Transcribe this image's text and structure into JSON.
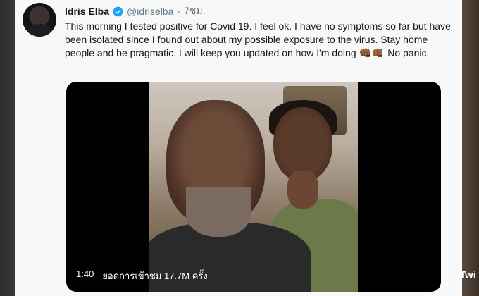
{
  "tweet": {
    "display_name": "Idris Elba",
    "handle": "@idriselba",
    "separator": "·",
    "time": "7ชม.",
    "text_main": "This morning I tested positive for Covid 19. I feel ok. I have no symptoms so far but have been isolated since I found out about my possible exposure to the virus.  Stay home people and be pragmatic. I will keep you updated on how I'm doing",
    "emojis": "👊🏾👊🏾",
    "text_end": "No panic."
  },
  "video": {
    "duration": "1:40",
    "views": "ยอดการเข้าชม 17.7M ครั้ง"
  },
  "watermark": "Twi",
  "icons": {
    "verified": "verified-badge-icon"
  },
  "colors": {
    "background": "#f7f8f7",
    "text": "#14171a",
    "muted": "#657786",
    "verified": "#1da1f2"
  }
}
